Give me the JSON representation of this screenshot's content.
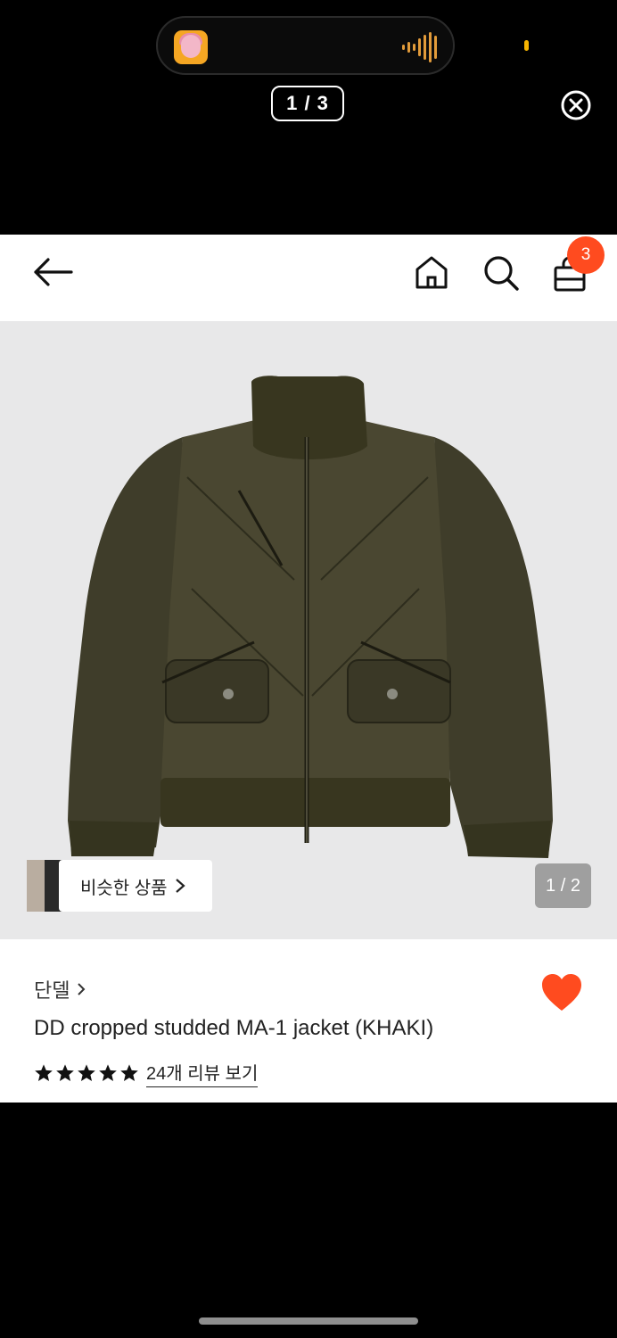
{
  "story": {
    "counter": "1 / 3",
    "accent_color": "#e29b3a"
  },
  "header": {
    "cart_count": "3",
    "badge_color": "#ff4b1f"
  },
  "hero": {
    "similar_label": "비슷한 상품",
    "page_indicator": "1 / 2"
  },
  "product": {
    "brand": "단델",
    "title": "DD cropped studded MA-1 jacket (KHAKI)",
    "rating_stars": 5,
    "review_link": "24개 리뷰 보기",
    "liked": true,
    "heart_color": "#ff4b1f"
  },
  "icons": [
    "back-arrow-icon",
    "home-icon",
    "search-icon",
    "cart-icon",
    "close-icon",
    "chevron-right-icon",
    "heart-icon",
    "star-icon"
  ]
}
